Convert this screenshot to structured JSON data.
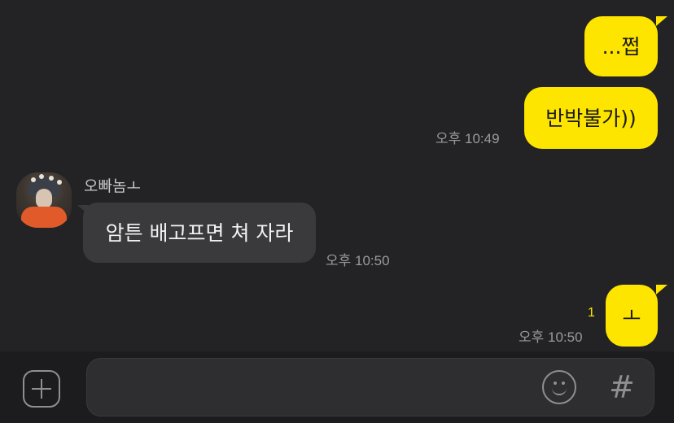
{
  "messages": [
    {
      "sender": "me",
      "text": "...쩝"
    },
    {
      "sender": "me",
      "text": "반박불가))",
      "time": "오후 10:49"
    },
    {
      "sender": "other",
      "name": "오빠놈ㅗ",
      "text": "암튼 배고프면 쳐 자라",
      "time": "오후 10:50"
    },
    {
      "sender": "me",
      "text": "ㅗ",
      "time": "오후 10:50",
      "unread": "1"
    }
  ],
  "input": {
    "placeholder": "",
    "value": ""
  },
  "icons": {
    "attach": "plus-icon",
    "emoji": "emoji-icon",
    "hashtag": "hashtag-icon"
  },
  "colors": {
    "my_bubble": "#FEE500",
    "other_bubble": "#3A3A3C",
    "background": "#232325",
    "unread_count": "#FEE500"
  }
}
